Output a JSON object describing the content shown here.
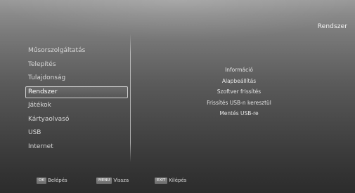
{
  "header": {
    "title": "Rendszer"
  },
  "left_menu": {
    "items": [
      {
        "label": "Műsorszolgáltatás"
      },
      {
        "label": "Telepítés"
      },
      {
        "label": "Tulajdonság"
      },
      {
        "label": "Rendszer",
        "selected": true
      },
      {
        "label": "Játékok"
      },
      {
        "label": "Kártyaolvasó"
      },
      {
        "label": "USB"
      },
      {
        "label": "Internet"
      }
    ]
  },
  "submenu": {
    "items": [
      {
        "label": "Információ"
      },
      {
        "label": "Alapbeállítás"
      },
      {
        "label": "Szoftver frissítés"
      },
      {
        "label": "Frissítés USB-n keresztül"
      },
      {
        "label": "Mentés USB-re"
      }
    ]
  },
  "footer": {
    "hints": [
      {
        "key": "OK",
        "label": "Belépés"
      },
      {
        "key": "MENU",
        "label": "Vissza"
      },
      {
        "key": "EXIT",
        "label": "Kilépés"
      }
    ]
  }
}
